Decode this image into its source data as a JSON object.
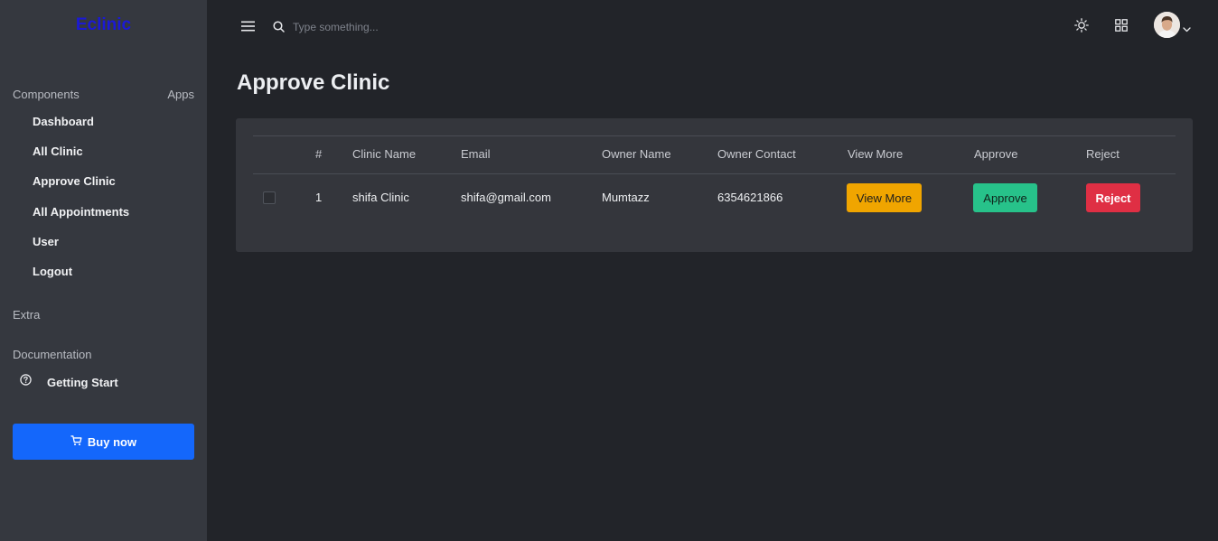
{
  "sidebar": {
    "brand": "Eclinic",
    "section_components": "Components",
    "section_apps": "Apps",
    "items": [
      {
        "label": "Dashboard"
      },
      {
        "label": "All Clinic"
      },
      {
        "label": "Approve Clinic"
      },
      {
        "label": "All Appointments"
      },
      {
        "label": "User"
      },
      {
        "label": "Logout"
      }
    ],
    "section_extra": "Extra",
    "section_documentation": "Documentation",
    "getting_start": {
      "label": "Getting Start",
      "icon": "question-circle-icon"
    },
    "buy_button": {
      "label": "Buy now",
      "icon": "cart-icon"
    }
  },
  "topbar": {
    "search_placeholder": "Type something...",
    "icons": [
      "menu-icon",
      "search-icon",
      "sun-icon",
      "grid-icon",
      "avatar",
      "chevron-down-icon"
    ]
  },
  "main": {
    "title": "Approve Clinic",
    "table": {
      "headers": {
        "index": "#",
        "clinic_name": "Clinic Name",
        "email": "Email",
        "owner_name": "Owner Name",
        "owner_contact": "Owner Contact",
        "view_more": "View More",
        "approve": "Approve",
        "reject": "Reject"
      },
      "rows": [
        {
          "index": "1",
          "clinic_name": "shifa Clinic",
          "email": "shifa@gmail.com",
          "owner_name": "Mumtazz",
          "owner_contact": "6354621866",
          "view_more_label": "View More",
          "approve_label": "Approve",
          "reject_label": "Reject"
        }
      ]
    }
  },
  "colors": {
    "sidebar_bg": "#35383f",
    "page_bg": "#222429",
    "card_bg": "#34363c",
    "brand": "#1b19d6",
    "primary": "#1467fb",
    "warning": "#f0a500",
    "success": "#27c28a",
    "danger": "#df2f44"
  }
}
